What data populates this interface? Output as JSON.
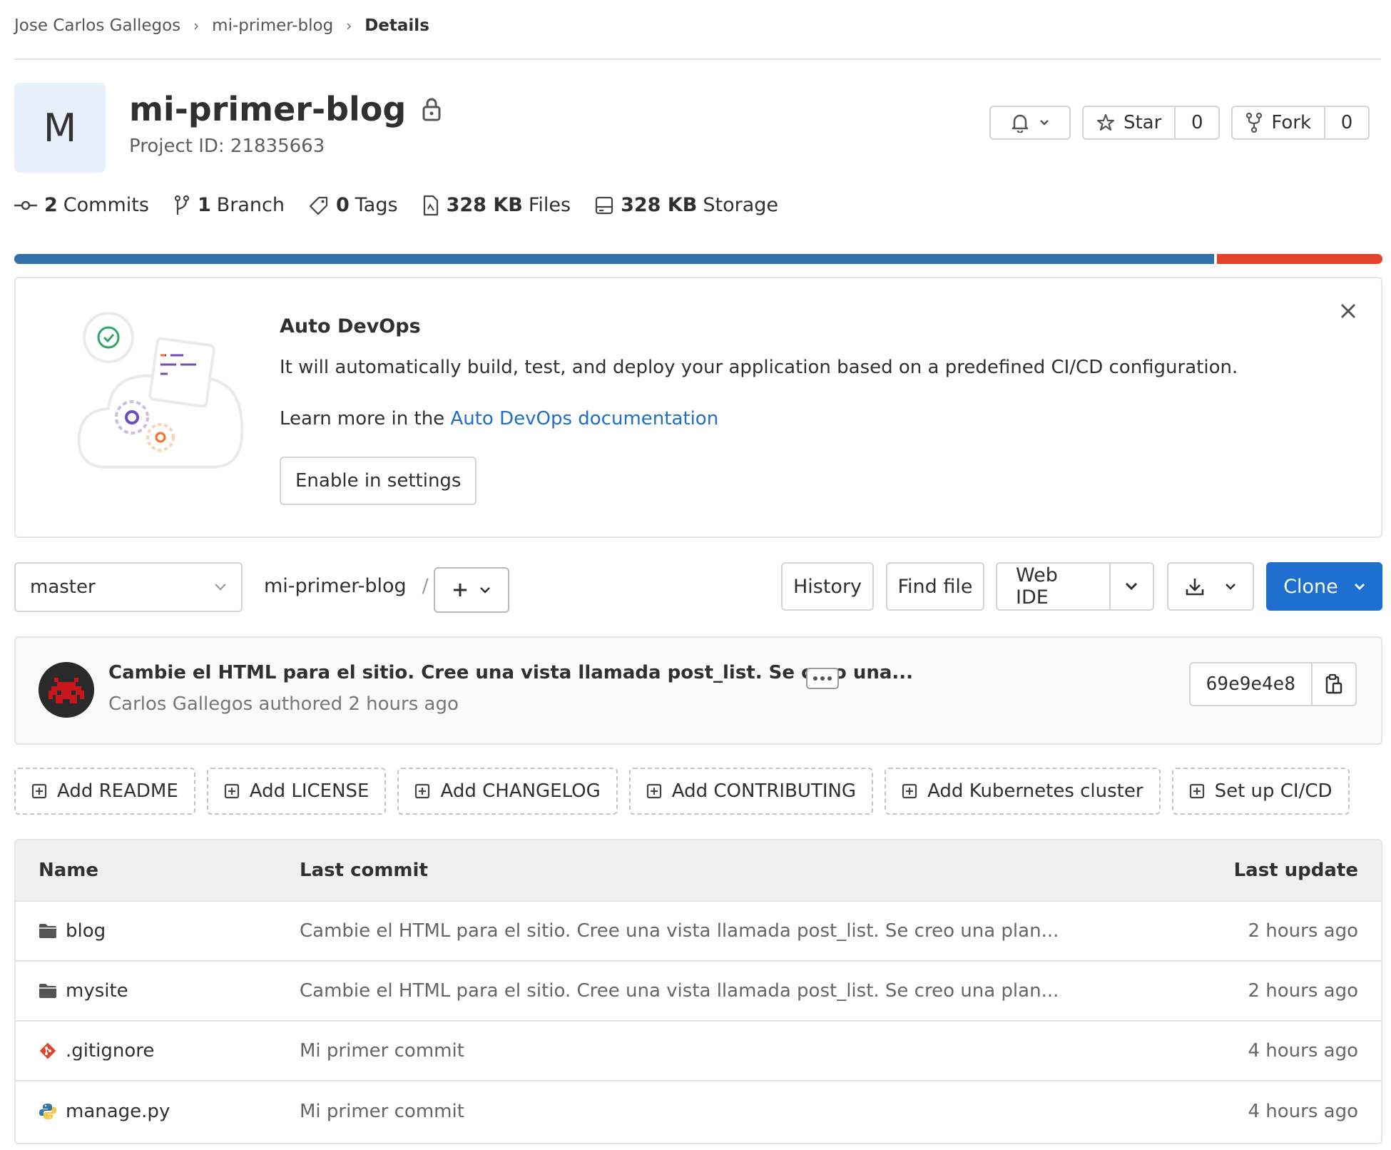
{
  "breadcrumb": {
    "items": [
      "Jose Carlos Gallegos",
      "mi-primer-blog"
    ],
    "current": "Details"
  },
  "project": {
    "avatar_letter": "M",
    "name": "mi-primer-blog",
    "id_text": "Project ID: 21835663"
  },
  "header_buttons": {
    "star_label": "Star",
    "star_count": "0",
    "fork_label": "Fork",
    "fork_count": "0"
  },
  "stats": {
    "commits": {
      "count": "2",
      "label": "Commits"
    },
    "branches": {
      "count": "1",
      "label": "Branch"
    },
    "tags": {
      "count": "0",
      "label": "Tags"
    },
    "files": {
      "count": "328 KB",
      "label": "Files"
    },
    "storage": {
      "count": "328 KB",
      "label": "Storage"
    }
  },
  "storage_bar": {
    "segment_a_fraction": 0.877,
    "color_a": "#3170a8",
    "color_b": "#e24329"
  },
  "auto_devops": {
    "title": "Auto DevOps",
    "description": "It will automatically build, test, and deploy your application based on a predefined CI/CD configuration.",
    "learn_prefix": "Learn more in the ",
    "learn_link": "Auto DevOps documentation",
    "button": "Enable in settings"
  },
  "toolbar": {
    "branch": "master",
    "path": "mi-primer-blog",
    "path_sep": "/",
    "history": "History",
    "find_file": "Find file",
    "web_ide": "Web IDE",
    "clone": "Clone"
  },
  "last_commit": {
    "title": "Cambie el HTML para el sitio. Cree una vista llamada post_list. Se creo una...",
    "meta": "Carlos Gallegos authored 2 hours ago",
    "sha": "69e9e4e8"
  },
  "quick_actions": [
    "Add README",
    "Add LICENSE",
    "Add CHANGELOG",
    "Add CONTRIBUTING",
    "Add Kubernetes cluster",
    "Set up CI/CD"
  ],
  "file_table": {
    "headers": {
      "name": "Name",
      "last_commit": "Last commit",
      "last_update": "Last update"
    },
    "rows": [
      {
        "icon": "folder-icon",
        "name": "blog",
        "commit": "Cambie el HTML para el sitio. Cree una vista llamada post_list. Se creo una plan...",
        "updated": "2 hours ago"
      },
      {
        "icon": "folder-icon",
        "name": "mysite",
        "commit": "Cambie el HTML para el sitio. Cree una vista llamada post_list. Se creo una plan...",
        "updated": "2 hours ago"
      },
      {
        "icon": "git-icon",
        "name": ".gitignore",
        "commit": "Mi primer commit",
        "updated": "4 hours ago"
      },
      {
        "icon": "python-icon",
        "name": "manage.py",
        "commit": "Mi primer commit",
        "updated": "4 hours ago"
      }
    ]
  },
  "colors": {
    "primary_blue": "#1f6fd0",
    "link": "#1f6ec7"
  }
}
